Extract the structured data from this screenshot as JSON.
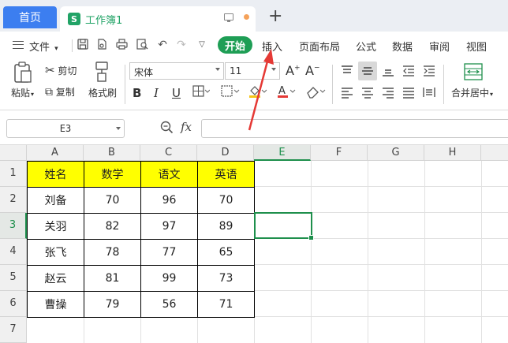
{
  "titlebar": {
    "home_tab": "首页",
    "doc_tab": "工作簿1",
    "new_tab_icon": "plus-icon"
  },
  "menubar": {
    "file_label": "文件",
    "start_label": "开始",
    "items": [
      "插入",
      "页面布局",
      "公式",
      "数据",
      "审阅",
      "视图"
    ]
  },
  "toolbar": {
    "paste_label": "粘贴",
    "cut_label": "剪切",
    "copy_label": "复制",
    "format_painter_label": "格式刷",
    "font_name": "宋体",
    "font_size": "11",
    "merge_label": "合并居中",
    "colors": {
      "fill": "#f5c518",
      "font": "#e53935"
    }
  },
  "formulabar": {
    "name_box": "E3",
    "fx": "fx",
    "formula": ""
  },
  "sheet": {
    "columns": [
      "A",
      "B",
      "C",
      "D",
      "E",
      "F",
      "G",
      "H"
    ],
    "rows": [
      "1",
      "2",
      "3",
      "4",
      "5",
      "6",
      "7"
    ],
    "selected_column": "E",
    "selected_row": "3",
    "table": {
      "headers": [
        "姓名",
        "数学",
        "语文",
        "英语"
      ],
      "rows": [
        [
          "刘备",
          "70",
          "96",
          "70"
        ],
        [
          "关羽",
          "82",
          "97",
          "89"
        ],
        [
          "张飞",
          "78",
          "77",
          "65"
        ],
        [
          "赵云",
          "81",
          "99",
          "73"
        ],
        [
          "曹操",
          "79",
          "56",
          "71"
        ]
      ]
    }
  },
  "colors": {
    "accent_green": "#1e8f4c",
    "home_tab_blue": "#3c7ef0",
    "header_yellow": "#ffff00",
    "arrow_red": "#e53935"
  }
}
